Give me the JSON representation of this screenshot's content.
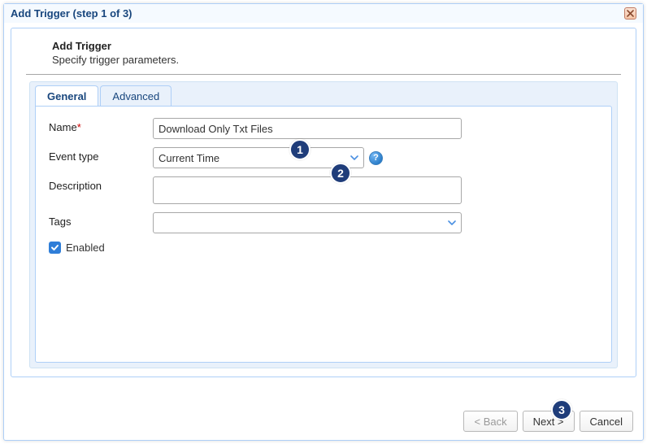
{
  "window": {
    "title": "Add Trigger (step 1 of 3)"
  },
  "heading": {
    "title": "Add Trigger",
    "subtitle": "Specify trigger parameters."
  },
  "tabs": {
    "general": "General",
    "advanced": "Advanced",
    "active": "general"
  },
  "form": {
    "name_label": "Name",
    "name_required_mark": "*",
    "name_value": "Download Only Txt Files",
    "event_type_label": "Event type",
    "event_type_value": "Current Time",
    "description_label": "Description",
    "description_value": "",
    "tags_label": "Tags",
    "tags_value": "",
    "enabled_label": "Enabled",
    "enabled_checked": true,
    "help_icon_label": "?"
  },
  "buttons": {
    "back": "< Back",
    "next": "Next >",
    "cancel": "Cancel"
  },
  "callouts": {
    "c1": "1",
    "c2": "2",
    "c3": "3"
  },
  "colors": {
    "accent_blue": "#18467d",
    "combo_caret": "#4a90e2",
    "callout_bg": "#1f3d7a"
  }
}
